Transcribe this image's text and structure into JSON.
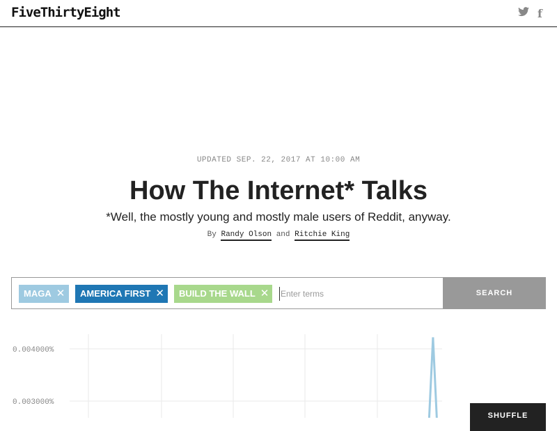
{
  "header": {
    "logo": "FiveThirtyEight",
    "twitter_icon": "twitter-icon",
    "facebook_icon": "facebook-icon"
  },
  "article": {
    "updated": "UPDATED SEP. 22, 2017 AT 10:00 AM",
    "title": "How The Internet* Talks",
    "subtitle": "*Well, the mostly young and mostly male users of Reddit, anyway.",
    "by": "By",
    "and": "and",
    "author1": "Randy Olson",
    "author2": "Ritchie King"
  },
  "search": {
    "tags": [
      {
        "label": "MAGA",
        "color": "#9ecae1"
      },
      {
        "label": "AMERICA FIRST",
        "color": "#1f77b4"
      },
      {
        "label": "BUILD THE WALL",
        "color": "#a8d88c"
      }
    ],
    "placeholder": "Enter terms",
    "button": "SEARCH"
  },
  "chart_data": {
    "type": "line",
    "yticks": [
      "0.004000%",
      "0.003000%"
    ],
    "series": [
      {
        "color": "#9ecae1",
        "x": [
          0,
          0.7,
          0.71,
          0.72,
          0.74
        ],
        "values": [
          0.0,
          0.0,
          0.00422,
          0.0,
          0.0
        ]
      }
    ]
  },
  "shuffle": {
    "label": "SHUFFLE"
  }
}
